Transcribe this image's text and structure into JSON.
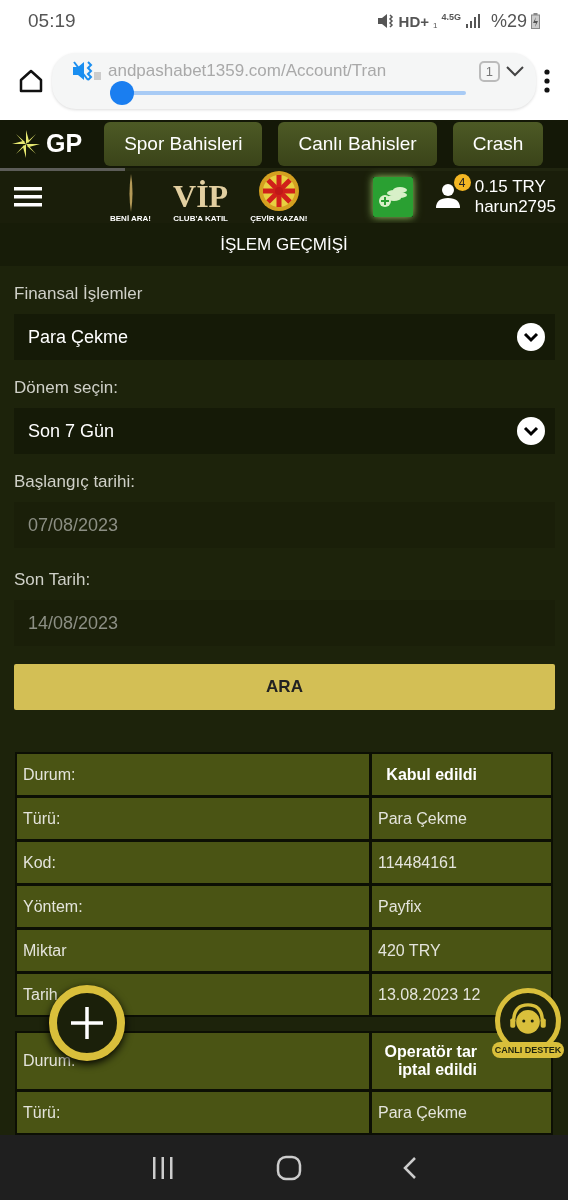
{
  "status_bar": {
    "time": "05:19",
    "network": "HD+",
    "network_sub": "1",
    "generation": "4.5G",
    "battery": "%29"
  },
  "browser": {
    "url": "andpashabet1359.com/Account/Tran",
    "sound_slider": {
      "level": 0
    },
    "tab_count": "1"
  },
  "top_nav": {
    "logo": "GP",
    "buttons": [
      {
        "label": "Spor Bahisleri"
      },
      {
        "label": "Canlı Bahisler"
      },
      {
        "label": "Crash"
      }
    ],
    "loading": {
      "level": 0.22
    }
  },
  "promo_bar": {
    "promos": [
      {
        "kind": "call",
        "caption": "BENİ ARA!"
      },
      {
        "kind": "vip",
        "logo": "VİP",
        "caption": "CLUB'A KATIL"
      },
      {
        "kind": "wheel",
        "caption": "ÇEVİR KAZAN!"
      }
    ],
    "notifications": "4",
    "balance": "0.15 TRY",
    "username": "harun2795"
  },
  "page_title": "İŞLEM GEÇMİŞİ",
  "form": {
    "fields": [
      {
        "kind": "select",
        "label": "Finansal İşlemler",
        "value": "Para Çekme"
      },
      {
        "kind": "select",
        "label": "Dönem seçin:",
        "value": "Son 7 Gün"
      },
      {
        "kind": "date",
        "label": "Başlangıç tarihi:",
        "value": "07/08/2023"
      },
      {
        "kind": "date",
        "label": "Son Tarih:",
        "value": "14/08/2023"
      }
    ],
    "search_button": "ARA"
  },
  "transactions": [
    {
      "rows": [
        {
          "label": "Durum:",
          "value": "Kabul edildi",
          "kind": "status"
        },
        {
          "label": "Türü:",
          "value": "Para Çekme"
        },
        {
          "label": "Kod:",
          "value": "114484161"
        },
        {
          "label": "Yöntem:",
          "value": "Payfix"
        },
        {
          "label": "Miktar",
          "value": "420 TRY"
        },
        {
          "label": "Tarih",
          "value": "13.08.2023 12"
        }
      ]
    },
    {
      "rows": [
        {
          "label": "Durum.",
          "value": "Operatör tar\niptal edildi",
          "kind": "status"
        },
        {
          "label": "Türü:",
          "value": "Para Çekme"
        }
      ]
    }
  ],
  "support_badge": "CANLI DESTEK"
}
